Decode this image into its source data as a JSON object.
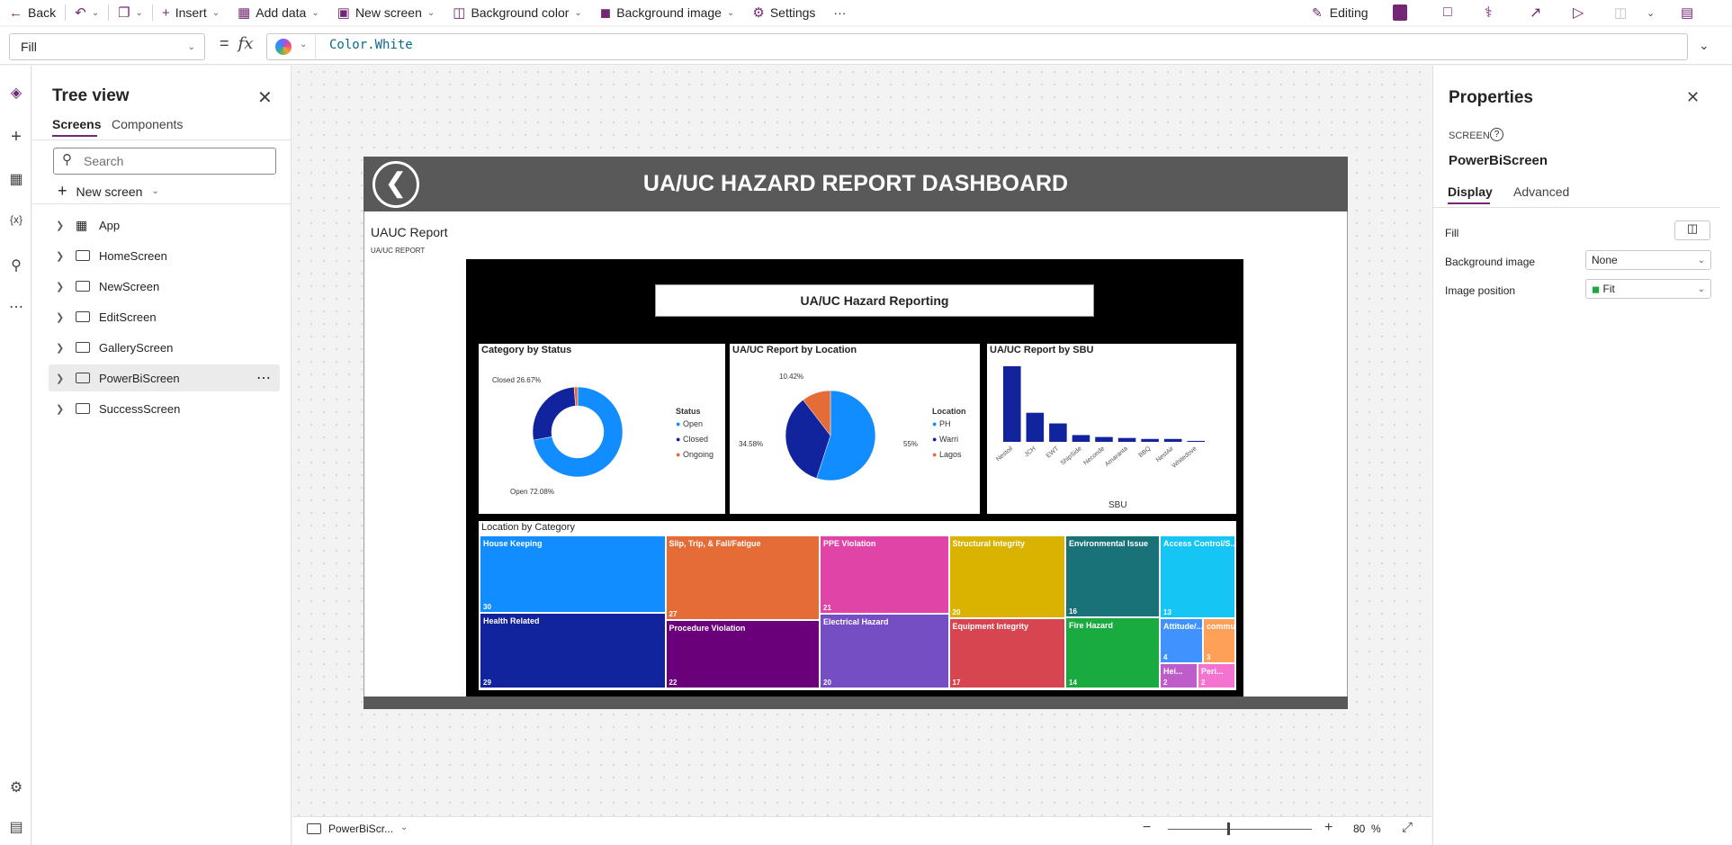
{
  "toolbar": {
    "back": "Back",
    "insert": "Insert",
    "add_data": "Add data",
    "new_screen": "New screen",
    "background_color": "Background color",
    "background_image": "Background image",
    "settings": "Settings",
    "more": "···",
    "editing": "Editing"
  },
  "formula": {
    "property": "Fill",
    "eq": "=",
    "fx": "fx",
    "value": "Color.White"
  },
  "tree": {
    "title": "Tree view",
    "tabs": [
      "Screens",
      "Components"
    ],
    "search_placeholder": "Search",
    "new_screen": "New screen",
    "items": [
      "App",
      "HomeScreen",
      "NewScreen",
      "EditScreen",
      "GalleryScreen",
      "PowerBiScreen",
      "SuccessScreen"
    ],
    "selected_index": 5
  },
  "app_screen": {
    "header_title": "UA/UC HAZARD REPORT DASHBOARD",
    "tile_title": "UAUC Report",
    "tile_subtitle": "UA/UC REPORT",
    "report_title": "UA/UC Hazard Reporting"
  },
  "chart_data": [
    {
      "type": "pie",
      "title": "Category by Status",
      "legend_title": "Status",
      "categories": [
        "Open",
        "Closed",
        "Ongoing"
      ],
      "values": [
        72.08,
        26.67,
        1.25
      ],
      "labels": [
        "Open 72.08%",
        "Closed 26.67%"
      ],
      "colors": [
        "#118dff",
        "#12239e",
        "#e66c37"
      ],
      "donut": true
    },
    {
      "type": "pie",
      "title": "UA/UC Report by Location",
      "legend_title": "Location",
      "categories": [
        "PH",
        "Warri",
        "Lagos"
      ],
      "values": [
        55,
        34.58,
        10.42
      ],
      "labels": [
        "55%",
        "34.58%",
        "10.42%"
      ],
      "colors": [
        "#118dff",
        "#12239e",
        "#e66c37"
      ]
    },
    {
      "type": "bar",
      "title": "UA/UC Report by SBU",
      "xlabel": "SBU",
      "categories": [
        "Nestoil",
        "JCH",
        "EWT",
        "ShipSide",
        "Neconde",
        "Amaranta",
        "BBQ",
        "NestAir",
        "Whitedove"
      ],
      "values": [
        78,
        30,
        19,
        7,
        5,
        4,
        3,
        3,
        1
      ],
      "color": "#12239e"
    },
    {
      "type": "treemap",
      "title": "Location by Category",
      "items": [
        {
          "label": "House Keeping",
          "value": 30,
          "color": "#118dff"
        },
        {
          "label": "Health Related",
          "value": 29,
          "color": "#12239e"
        },
        {
          "label": "Slip, Trip, & Fall/Fatigue",
          "value": 27,
          "color": "#e66c37"
        },
        {
          "label": "Procedure Violation",
          "value": 22,
          "color": "#6b007b"
        },
        {
          "label": "PPE Violation",
          "value": 21,
          "color": "#e044a7"
        },
        {
          "label": "Electrical Hazard",
          "value": 20,
          "color": "#744ec2"
        },
        {
          "label": "Structural Integrity",
          "value": 20,
          "color": "#d9b300"
        },
        {
          "label": "Equipment Integrity",
          "value": 17,
          "color": "#d64550"
        },
        {
          "label": "Environmental Issue",
          "value": 16,
          "color": "#197278"
        },
        {
          "label": "Fire Hazard",
          "value": 14,
          "color": "#1aab40"
        },
        {
          "label": "Access Control/S...",
          "value": 13,
          "color": "#15c6f4"
        },
        {
          "label": "Attitude/...",
          "value": 4,
          "color": "#4092ff"
        },
        {
          "label": "communi...",
          "value": 3,
          "color": "#ffa058"
        },
        {
          "label": "Hei...",
          "value": 2,
          "color": "#be5dc9"
        },
        {
          "label": "Peri...",
          "value": 2,
          "color": "#f472d0"
        }
      ]
    }
  ],
  "bottom": {
    "screen_name": "PowerBiScr...",
    "zoom": "80",
    "zoom_unit": "%"
  },
  "properties": {
    "title": "Properties",
    "kind": "SCREEN",
    "name": "PowerBiScreen",
    "tabs": [
      "Display",
      "Advanced"
    ],
    "fill_label": "Fill",
    "bg_image_label": "Background image",
    "bg_image_value": "None",
    "image_position_label": "Image position",
    "image_position_value": "Fit"
  }
}
